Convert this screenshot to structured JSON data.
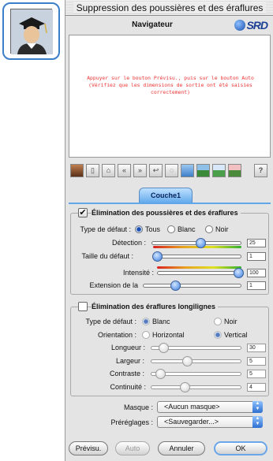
{
  "window": {
    "title": "Suppression des poussières et des éraflures"
  },
  "navigator": {
    "title": "Navigateur",
    "logo": "SRD",
    "message": "Appuyer sur le bouton Prévisu., puis sur le bouton Auto (Vérifiez que les dimensions de sortie ont été saisies correctement)"
  },
  "toolbar": {
    "icons": [
      "portrait-icon",
      "page-icon",
      "trash-icon",
      "rewind-icon",
      "forward-icon",
      "undo-icon",
      "lasso-icon",
      "zoom-fit-icon",
      "landscape-icon",
      "landscape-green-icon",
      "landscape-red-icon",
      "help-icon"
    ],
    "help_label": "?"
  },
  "tab": {
    "label": "Couche1"
  },
  "dust": {
    "enabled": true,
    "title": "Élimination des poussières et des éraflures",
    "type_label": "Type de défaut :",
    "options": [
      "Tous",
      "Blanc",
      "Noir"
    ],
    "selected": "Tous",
    "sliders": [
      {
        "label": "Détection :",
        "value": "25",
        "level": 0.55
      },
      {
        "label": "Taille du défaut :",
        "value": "1",
        "level": 0.0
      },
      {
        "label": "Intensité :",
        "value": "100",
        "level": 1.0
      },
      {
        "label": "Extension de la",
        "value": "1",
        "level": 0.32
      }
    ]
  },
  "linear": {
    "enabled": false,
    "title": "Élimination des éraflures longilignes",
    "type_label": "Type de défaut :",
    "type_options": [
      "Blanc",
      "Noir"
    ],
    "type_selected": "Blanc",
    "orientation_label": "Orientation :",
    "orientation_options": [
      "Horizontal",
      "Vertical"
    ],
    "orientation_selected": "Vertical",
    "sliders": [
      {
        "label": "Longueur :",
        "value": "30",
        "level": 0.12
      },
      {
        "label": "Largeur :",
        "value": "5",
        "level": 0.4
      },
      {
        "label": "Contraste :",
        "value": "5",
        "level": 0.08
      },
      {
        "label": "Continuité :",
        "value": "4",
        "level": 0.37
      }
    ]
  },
  "mask": {
    "label": "Masque :",
    "value": "<Aucun masque>"
  },
  "presets": {
    "label": "Préréglages :",
    "value": "<Sauvegarder...>"
  },
  "buttons": {
    "preview": "Prévisu.",
    "auto": "Auto",
    "cancel": "Annuler",
    "ok": "OK"
  },
  "colors": {
    "accent": "#3a7de0",
    "message": "#ee3333",
    "tab": "#5fa7ea"
  }
}
